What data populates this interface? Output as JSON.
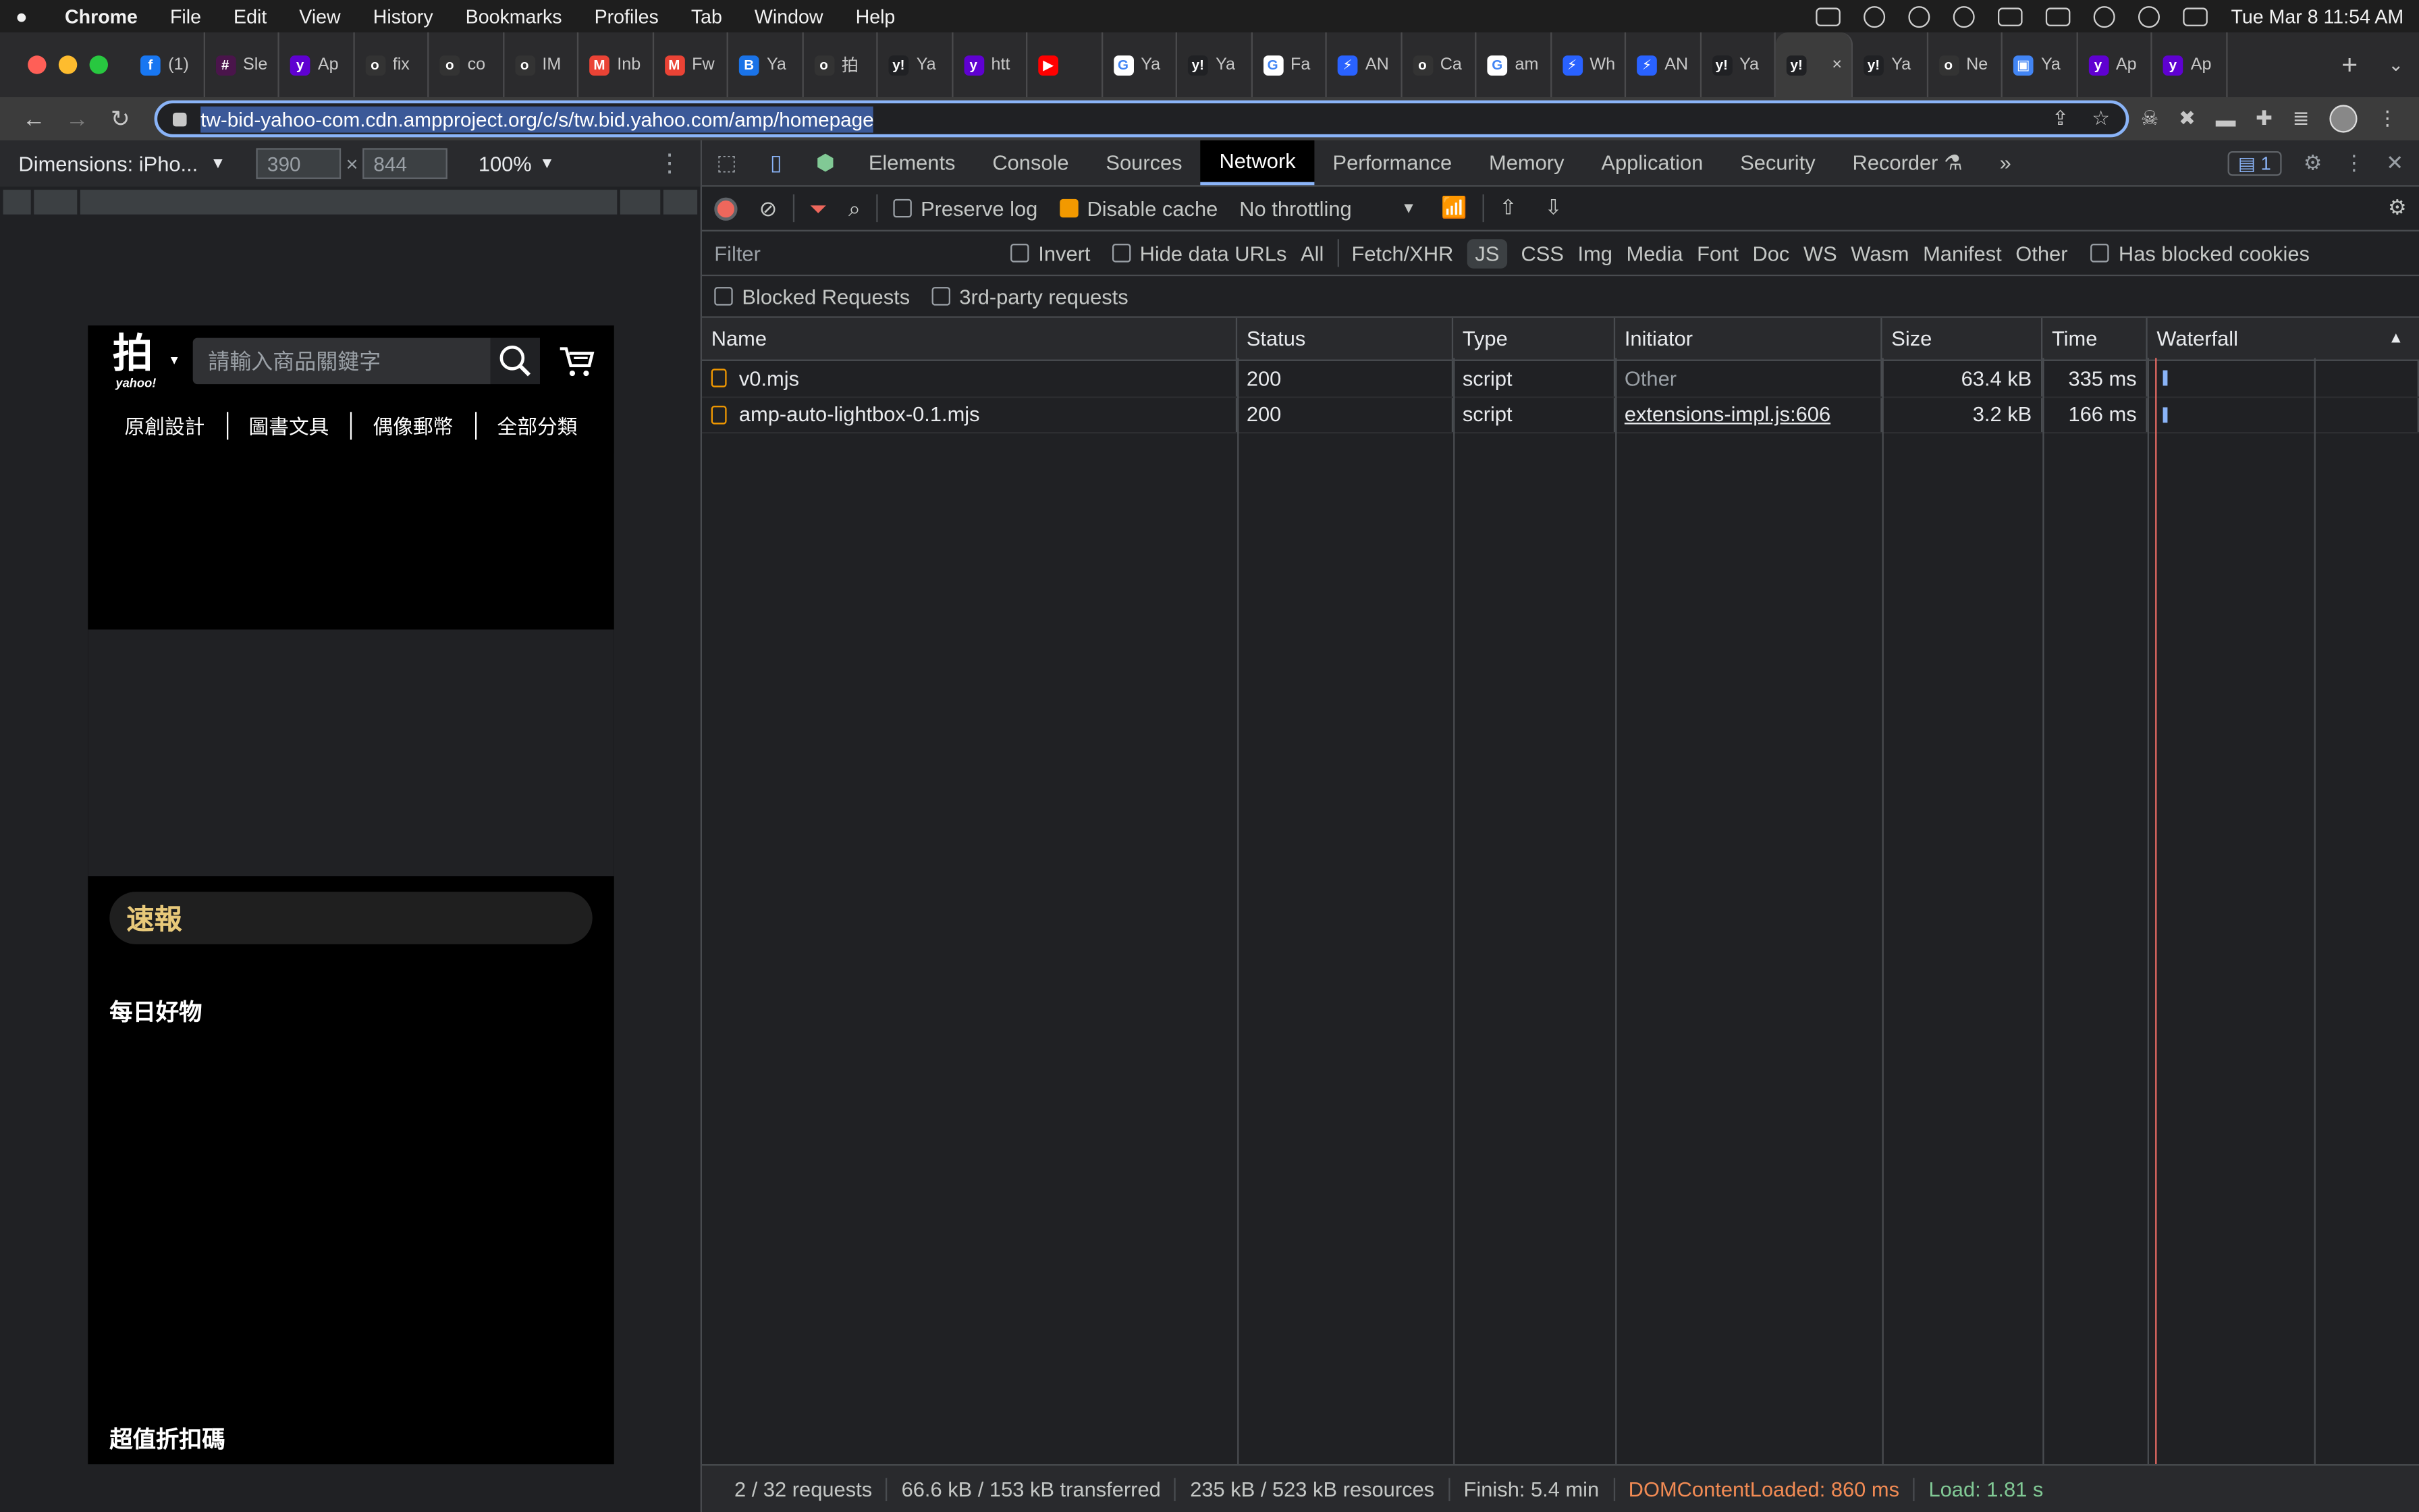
{
  "menubar": {
    "app": "Chrome",
    "items": [
      "File",
      "Edit",
      "View",
      "History",
      "Bookmarks",
      "Profiles",
      "Tab",
      "Window",
      "Help"
    ],
    "clock": "Tue Mar 8  11:54 AM"
  },
  "tabs": [
    {
      "label": "(1)",
      "color": "#1877f2",
      "glyph": "f"
    },
    {
      "label": "Sle",
      "color": "#4a154b",
      "glyph": "#"
    },
    {
      "label": "Ap",
      "color": "#5f01d1",
      "glyph": "y"
    },
    {
      "label": "fix",
      "color": "#333333",
      "glyph": "o"
    },
    {
      "label": "co",
      "color": "#333333",
      "glyph": "o"
    },
    {
      "label": "IM",
      "color": "#333333",
      "glyph": "o"
    },
    {
      "label": "Inb",
      "color": "#ea4335",
      "glyph": "M"
    },
    {
      "label": "Fw",
      "color": "#ea4335",
      "glyph": "M"
    },
    {
      "label": "Ya",
      "color": "#1a73e8",
      "glyph": "B"
    },
    {
      "label": "拍",
      "color": "#333333",
      "glyph": "o"
    },
    {
      "label": "Ya",
      "color": "#202124",
      "glyph": "y!"
    },
    {
      "label": "htt",
      "color": "#5f01d1",
      "glyph": "y"
    },
    {
      "label": "",
      "color": "#ff0000",
      "glyph": "▶"
    },
    {
      "label": "Ya",
      "color": "#ffffff",
      "glyph": "G"
    },
    {
      "label": "Ya",
      "color": "#202124",
      "glyph": "y!"
    },
    {
      "label": "Fa",
      "color": "#ffffff",
      "glyph": "G"
    },
    {
      "label": "AN",
      "color": "#2962ff",
      "glyph": "⚡"
    },
    {
      "label": "Ca",
      "color": "#333333",
      "glyph": "o"
    },
    {
      "label": "am",
      "color": "#ffffff",
      "glyph": "G"
    },
    {
      "label": "Wh",
      "color": "#2962ff",
      "glyph": "⚡"
    },
    {
      "label": "AN",
      "color": "#2962ff",
      "glyph": "⚡"
    },
    {
      "label": "Ya",
      "color": "#202124",
      "glyph": "y!"
    },
    {
      "label": "",
      "color": "#202124",
      "glyph": "y!",
      "active": true
    },
    {
      "label": "Ya",
      "color": "#202124",
      "glyph": "y!"
    },
    {
      "label": "Ne",
      "color": "#333333",
      "glyph": "o"
    },
    {
      "label": "Ya",
      "color": "#4285f4",
      "glyph": "▣"
    },
    {
      "label": "Ap",
      "color": "#5f01d1",
      "glyph": "y"
    },
    {
      "label": "Ap",
      "color": "#5f01d1",
      "glyph": "y"
    }
  ],
  "toolbar": {
    "url": "tw-bid-yahoo-com.cdn.ampproject.org/c/s/tw.bid.yahoo.com/amp/homepage"
  },
  "device": {
    "dimensions_label": "Dimensions: iPho...",
    "width": "390",
    "height": "844",
    "zoom": "100%"
  },
  "phone": {
    "logo_glyph": "拍",
    "logo_brand": "yahoo!",
    "search_placeholder": "請輸入商品關鍵字",
    "nav": [
      "原創設計",
      "圖書文具",
      "偶像郵幣",
      "全部分類"
    ],
    "flash_label": "速報",
    "daily_label": "每日好物",
    "coupon_label": "超值折扣碼"
  },
  "devtools": {
    "tabs": [
      "Elements",
      "Console",
      "Sources",
      "Network",
      "Performance",
      "Memory",
      "Application",
      "Security",
      "Recorder"
    ],
    "active_tab": "Network",
    "issues_count": "1",
    "controls": {
      "preserve_log": "Preserve log",
      "disable_cache": "Disable cache",
      "throttling": "No throttling"
    },
    "filter": {
      "placeholder": "Filter",
      "invert": "Invert",
      "hide_data_urls": "Hide data URLs",
      "types": [
        "All",
        "Fetch/XHR",
        "JS",
        "CSS",
        "Img",
        "Media",
        "Font",
        "Doc",
        "WS",
        "Wasm",
        "Manifest",
        "Other"
      ],
      "active_type": "JS",
      "has_blocked_cookies": "Has blocked cookies",
      "blocked_requests": "Blocked Requests",
      "third_party": "3rd-party requests"
    },
    "columns": [
      "Name",
      "Status",
      "Type",
      "Initiator",
      "Size",
      "Time",
      "Waterfall"
    ],
    "rows": [
      {
        "name": "v0.mjs",
        "status": "200",
        "type": "script",
        "initiator": "Other",
        "size": "63.4 kB",
        "time": "335 ms"
      },
      {
        "name": "amp-auto-lightbox-0.1.mjs",
        "status": "200",
        "type": "script",
        "initiator": "extensions-impl.js:606",
        "size": "3.2 kB",
        "time": "166 ms"
      }
    ],
    "status": {
      "requests": "2 / 32 requests",
      "transferred": "66.6 kB / 153 kB transferred",
      "resources": "235 kB / 523 kB resources",
      "finish": "Finish: 5.4 min",
      "dcl": "DOMContentLoaded: 860 ms",
      "load": "Load: 1.81 s"
    }
  }
}
